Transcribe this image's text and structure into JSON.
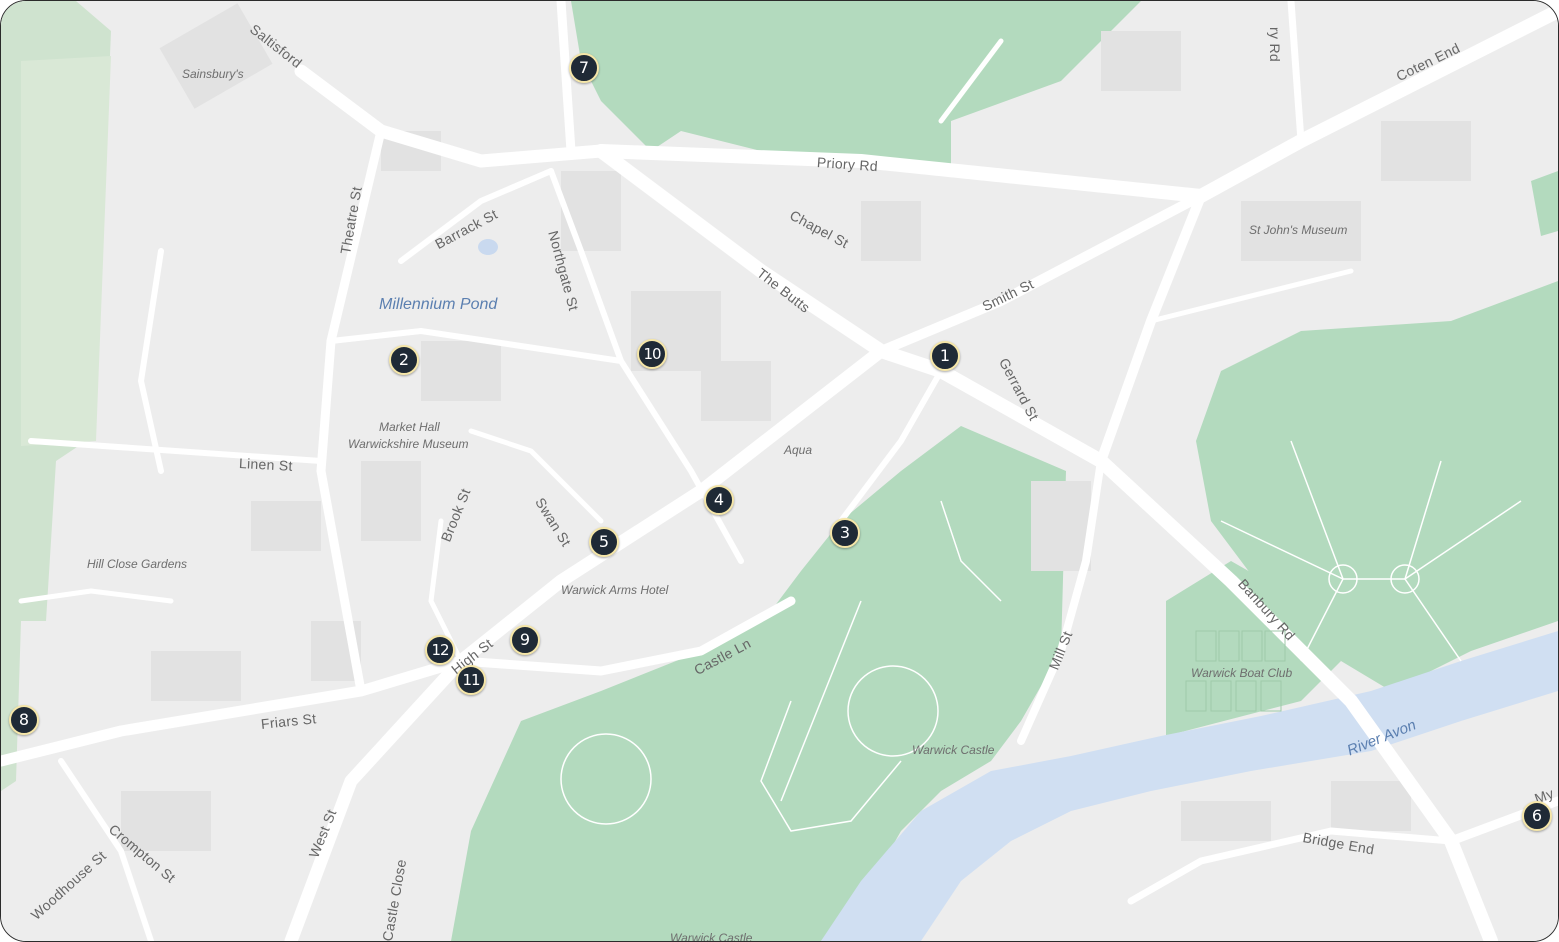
{
  "map": {
    "colors": {
      "land": "#ededed",
      "park": "#b3dabe",
      "water": "#d0dff2",
      "road": "#ffffff",
      "building": "#e2e2e2",
      "marker": "#1f2a36",
      "marker_ring": "#f5e6a8"
    },
    "roads": {
      "saltisford": "Saltisford",
      "theatre_st": "Theatre St",
      "barrack_st": "Barrack St",
      "northgate_st": "Northgate St",
      "priory_rd": "Priory Rd",
      "chapel_st": "Chapel St",
      "the_butts": "The Butts",
      "smith_st": "Smith St",
      "gerrard_st": "Gerrard St",
      "coten_end": "Coten End",
      "priory_top": "ry Rd",
      "linen_st": "Linen St",
      "brook_st": "Brook St",
      "swan_st": "Swan St",
      "high_st": "High St",
      "castle_ln": "Castle Ln",
      "friars_st": "Friars St",
      "west_st": "West St",
      "crompton_st": "Crompton St",
      "woodhouse_st": "Woodhouse St",
      "castle_close": "Castle Close",
      "mill_st": "Mill St",
      "banbury_rd": "Banbury Rd",
      "bridge_end": "Bridge End",
      "myton_partial": "My"
    },
    "places": {
      "sainsburys": "Sainsbury's",
      "millennium_pond": "Millennium Pond",
      "market_hall": "Market Hall",
      "warwickshire_museum": "Warwickshire Museum",
      "hill_close_gardens": "Hill Close Gardens",
      "warwick_arms_hotel": "Warwick Arms Hotel",
      "aqua": "Aqua",
      "st_johns_museum": "St John's Museum",
      "warwick_boat_club": "Warwick Boat Club",
      "warwick_castle": "Warwick Castle",
      "warwick_castle_bottom": "Warwick Castle",
      "river_avon": "River Avon"
    },
    "markers": [
      "1",
      "2",
      "3",
      "4",
      "5",
      "6",
      "7",
      "8",
      "9",
      "10",
      "11",
      "12"
    ]
  }
}
